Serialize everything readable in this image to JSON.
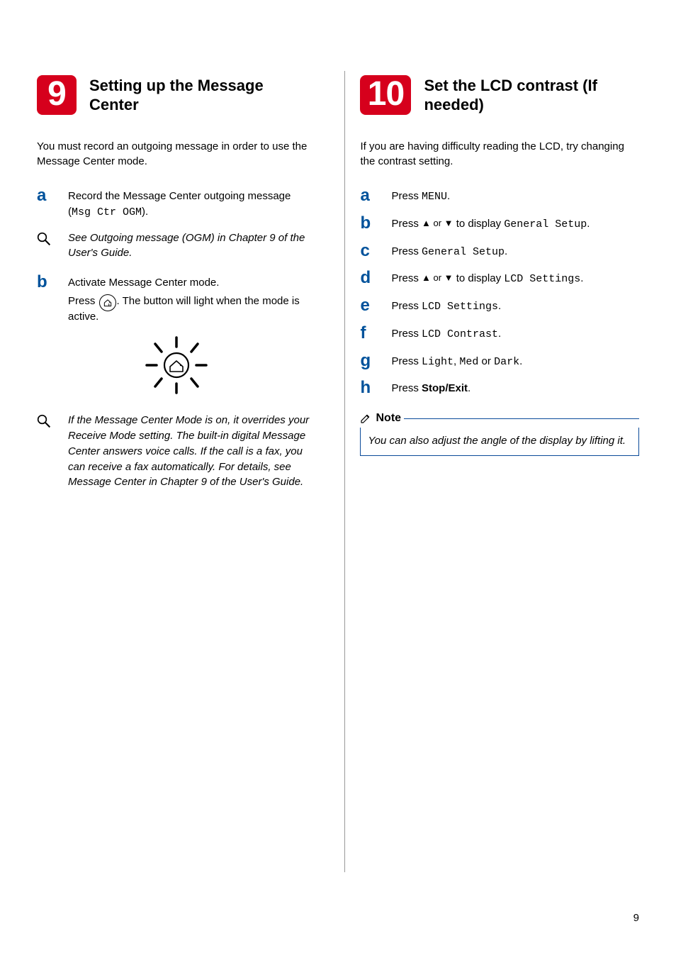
{
  "left": {
    "badge": "9",
    "title": "Setting up the Message Center",
    "intro": "You must record an outgoing message in order to use the Message Center mode.",
    "step_a": {
      "text_before_mono": "Record the Message Center outgoing message (",
      "mono": "Msg Ctr OGM",
      "text_after_mono": ")."
    },
    "ref1": "See Outgoing message (OGM) in Chapter 9 of the User's Guide.",
    "step_b": {
      "line1": "Activate Message Center mode.",
      "line2_before": "Press ",
      "line2_after": ". The button will light when the mode is active."
    },
    "ref2": "If the Message Center Mode is on, it overrides your Receive Mode setting. The built-in digital Message Center answers voice calls. If the call is a fax, you can receive a fax automatically.  For details, see Message Center in Chapter 9 of the User's Guide."
  },
  "right": {
    "badge": "10",
    "title": "Set the LCD contrast (If needed)",
    "intro": "If you are having difficulty reading the LCD, try changing the contrast setting.",
    "steps": {
      "a": {
        "pre": "Press ",
        "mono": "MENU",
        "post": "."
      },
      "b": {
        "pre": "Press ",
        "arrows": "▲ or ▼",
        "mid": " to display ",
        "mono": "General Setup",
        "post": "."
      },
      "c": {
        "pre": "Press ",
        "mono": "General Setup",
        "post": "."
      },
      "d": {
        "pre": "Press ",
        "arrows": "▲ or ▼",
        "mid": " to display ",
        "mono": "LCD Settings",
        "post": "."
      },
      "e": {
        "pre": "Press ",
        "mono": "LCD Settings",
        "post": "."
      },
      "f": {
        "pre": "Press ",
        "mono": "LCD Contrast",
        "post": "."
      },
      "g": {
        "pre": "Press ",
        "mono1": "Light",
        "sep1": ", ",
        "mono2": "Med",
        "sep2": " or ",
        "mono3": "Dark",
        "post": "."
      },
      "h": {
        "pre": "Press ",
        "bold": "Stop/Exit",
        "post": "."
      }
    },
    "note_label": "Note",
    "note_body": "You can also adjust the angle of the display by lifting it."
  },
  "page_number": "9"
}
